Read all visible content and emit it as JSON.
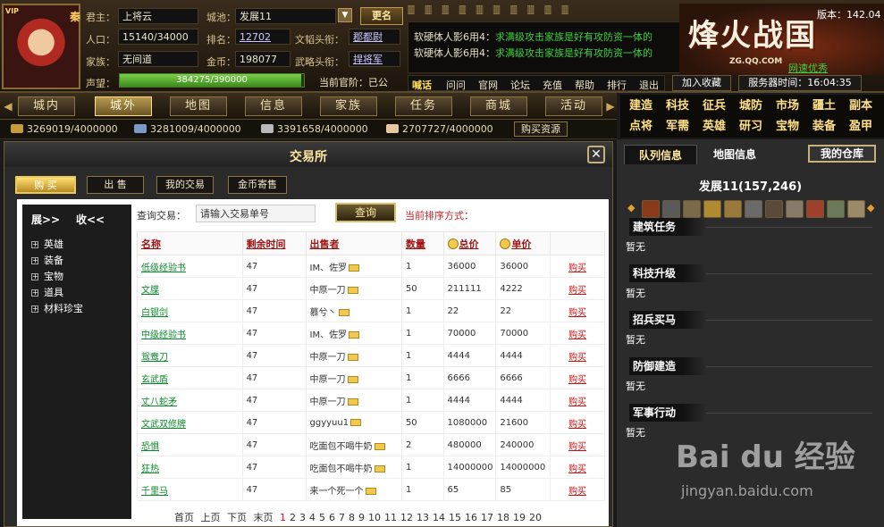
{
  "header": {
    "vip": "VIP",
    "country": "秦",
    "fields": [
      {
        "label": "君主：",
        "value": "上将云"
      },
      {
        "label": "人口：",
        "value": "15140/34000"
      },
      {
        "label": "家族：",
        "value": "无间道"
      },
      {
        "label": "声望：",
        "value": ""
      }
    ],
    "city_label": "城池：",
    "city_value": "发展11",
    "rank_label": "排名：",
    "rank_value": "12702",
    "gold_label": "金币：",
    "gold_value": "198077",
    "civil_title_label": "文韬头衔：",
    "civil_title_value": "郡都尉",
    "military_title_label": "武略头衔：",
    "military_title_value": "捍将军",
    "prestige_text": "384275/390000",
    "prestige_fraction": 0.9853,
    "official_rank": "当前官阶：已公",
    "rename_label": "更名",
    "dropdown_icon": "chevron-down-icon",
    "version": "版本：142.04",
    "ornament": "🀫 🀫 🀫 🀫 🀫 🀫 🀫 🀫 🀫 🀫",
    "news": [
      {
        "user": "软硬体人影6用4：",
        "msg": "求满级攻击家族是好有攻防资一体的"
      },
      {
        "user": "软硬体人影6用4：",
        "msg": "求满级攻击家族是好有攻防资一体的"
      }
    ],
    "logo": "烽火战国",
    "logo_sub": "ZG.QQ.COM",
    "net_status": "网速优秀",
    "top_links": [
      "喊话",
      "问问",
      "官网",
      "论坛",
      "充值",
      "帮助",
      "排行",
      "退出"
    ],
    "favorite_label": "加入收藏",
    "server_time": "服务器时间：16:04:35"
  },
  "nav": {
    "items": [
      "城内",
      "城外",
      "地图",
      "信息",
      "家族",
      "任务",
      "商城",
      "活动"
    ],
    "active_index": 1
  },
  "quick_grid": [
    "建造",
    "科技",
    "征兵",
    "城防",
    "市场",
    "疆土",
    "副本",
    "点将",
    "军需",
    "英雄",
    "研习",
    "宝物",
    "装备",
    "盈甲"
  ],
  "resources": [
    {
      "value": "3269019/4000000",
      "color": "#c89a3a"
    },
    {
      "value": "3281009/4000000",
      "color": "#7a9ac8"
    },
    {
      "value": "3391658/4000000",
      "color": "#b8b8b8"
    },
    {
      "value": "2707727/4000000",
      "color": "#e8c8a0"
    }
  ],
  "buy_resources_label": "购买资源",
  "exchange": {
    "title": "交易所",
    "close_icon": "close-icon",
    "tabs": [
      "购 买",
      "出 售",
      "我的交易",
      "金币寄售"
    ],
    "active_tab": 0,
    "expand": "展>>",
    "collapse": "收<<",
    "categories": [
      "英雄",
      "装备",
      "宝物",
      "道具",
      "材料珍宝"
    ],
    "query_label": "查询交易：",
    "query_value": "请输入交易单号",
    "query_button": "查询",
    "sort_label": "当前排序方式：",
    "columns": [
      "名称",
      "剩余时间",
      "出售者",
      "数量",
      "总价",
      "单价",
      ""
    ],
    "rows": [
      {
        "name": "低级经验书",
        "time": "47",
        "seller": "IM、佐罗",
        "qty": "1",
        "total": "36000",
        "unit": "36000",
        "buy": "购买"
      },
      {
        "name": "文牒",
        "time": "47",
        "seller": "中原一刀",
        "qty": "50",
        "total": "211111",
        "unit": "4222",
        "buy": "购买"
      },
      {
        "name": "白银剑",
        "time": "47",
        "seller": "慕兮丶",
        "qty": "1",
        "total": "22",
        "unit": "22",
        "buy": "购买"
      },
      {
        "name": "中级经验书",
        "time": "47",
        "seller": "IM、佐罗",
        "qty": "1",
        "total": "70000",
        "unit": "70000",
        "buy": "购买"
      },
      {
        "name": "鸳鸯刀",
        "time": "47",
        "seller": "中原一刀",
        "qty": "1",
        "total": "4444",
        "unit": "4444",
        "buy": "购买"
      },
      {
        "name": "玄武盾",
        "time": "47",
        "seller": "中原一刀",
        "qty": "1",
        "total": "6666",
        "unit": "6666",
        "buy": "购买"
      },
      {
        "name": "丈八蛇矛",
        "time": "47",
        "seller": "中原一刀",
        "qty": "1",
        "total": "4444",
        "unit": "4444",
        "buy": "购买"
      },
      {
        "name": "文武双修牌",
        "time": "47",
        "seller": "ggyyuu1",
        "qty": "50",
        "total": "1080000",
        "unit": "21600",
        "buy": "购买"
      },
      {
        "name": "恐惧",
        "time": "47",
        "seller": "吃面包不喝牛奶",
        "qty": "2",
        "total": "480000",
        "unit": "240000",
        "buy": "购买"
      },
      {
        "name": "狂热",
        "time": "47",
        "seller": "吃面包不喝牛奶",
        "qty": "1",
        "total": "14000000",
        "unit": "14000000",
        "buy": "购买"
      },
      {
        "name": "千里马",
        "time": "47",
        "seller": "来一个死一个",
        "qty": "1",
        "total": "65",
        "unit": "85",
        "buy": "购买"
      }
    ],
    "pager": {
      "first": "首页",
      "prev": "上页",
      "next": "下页",
      "last": "末页",
      "pages": [
        "1",
        "2",
        "3",
        "4",
        "5",
        "6",
        "7",
        "8",
        "9",
        "10",
        "11",
        "12",
        "13",
        "14",
        "15",
        "16",
        "17",
        "18",
        "19",
        "20"
      ],
      "current": "1"
    }
  },
  "right": {
    "tabs": [
      "队列信息",
      "地图信息"
    ],
    "active_tab": 0,
    "warehouse": "我的仓库",
    "city": "发展11(157,246)",
    "sections": [
      {
        "title": "建筑任务",
        "value": "暂无"
      },
      {
        "title": "科技升级",
        "value": "暂无"
      },
      {
        "title": "招兵买马",
        "value": "暂无"
      },
      {
        "title": "防御建造",
        "value": "暂无"
      },
      {
        "title": "军事行动",
        "value": "暂无"
      }
    ]
  },
  "watermark": "Bai du 经验",
  "watermark_sub": "jingyan.baidu.com"
}
